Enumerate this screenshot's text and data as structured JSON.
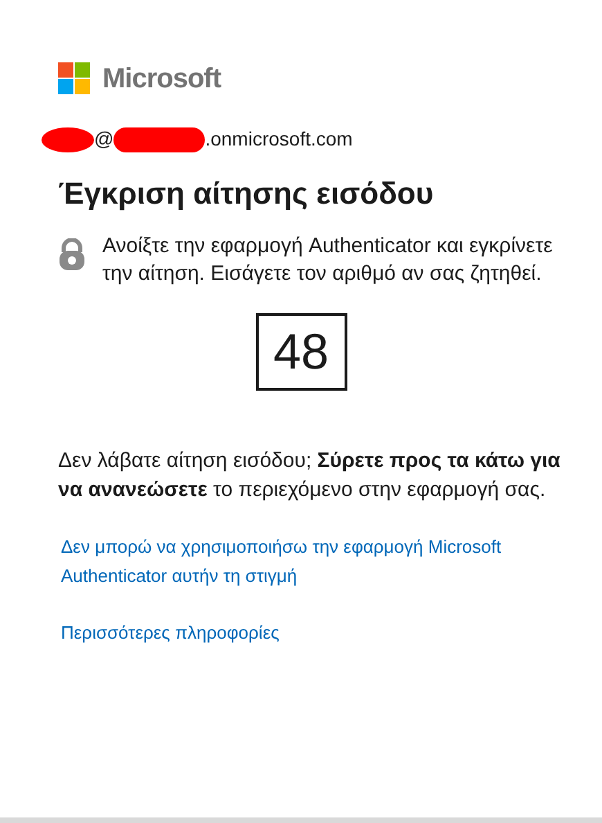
{
  "brand": {
    "name": "Microsoft"
  },
  "account": {
    "at": "@",
    "domain": ".onmicrosoft.com"
  },
  "title": "Έγκριση αίτησης εισόδου",
  "instruction": "Ανοίξτε την εφαρμογή Authenticator και εγκρίνετε την αίτηση. Εισάγετε τον αριθμό αν σας ζητηθεί.",
  "code": "48",
  "refresh_hint": "Δεν λάβατε αίτηση εισόδου; **Σύρετε προς τα κάτω για να ανανεώσετε** το περιεχόμενο στην εφαρμογή σας.",
  "links": [
    "Δεν μπορώ να χρησιμοποιήσω την εφαρμογή Microsoft Authenticator αυτήν τη στιγμή",
    "Περισσότερες πληροφορίες"
  ]
}
